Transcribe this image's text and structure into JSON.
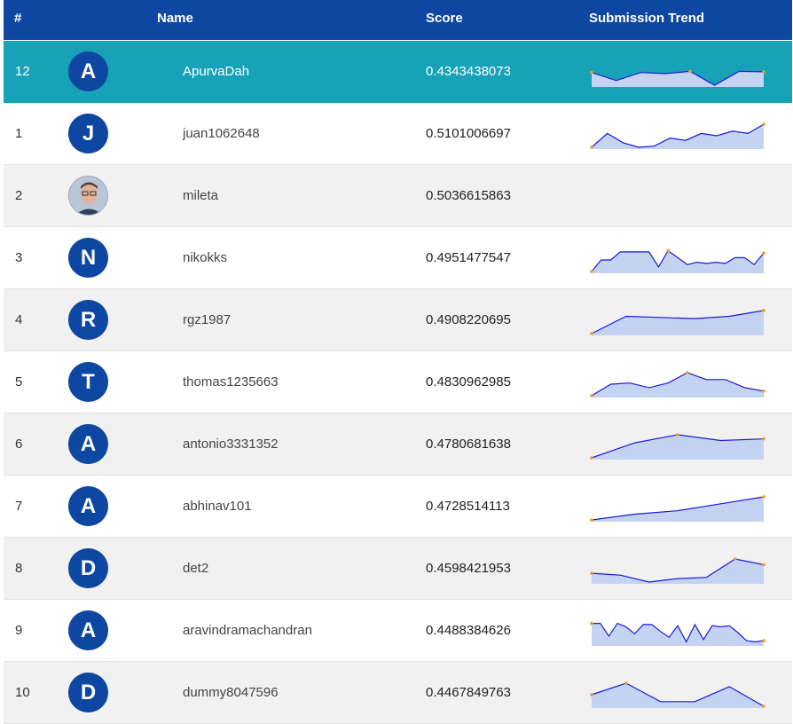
{
  "header": {
    "rank": "#",
    "name": "Name",
    "score": "Score",
    "trend": "Submission Trend"
  },
  "colors": {
    "header": "#0d47a1",
    "highlight": "#17a2b8",
    "avatar": "#0d47a1",
    "line": "#1a1ad6",
    "fill": "#c5d3f3",
    "marker": "#f29c2b"
  },
  "rows": [
    {
      "rank": "12",
      "initial": "A",
      "name": "ApurvaDah",
      "score": "0.4343438073",
      "highlight": true,
      "trend": [
        0.55,
        0.2,
        0.55,
        0.5,
        0.6,
        0.0,
        0.6,
        0.58
      ],
      "photo": false
    },
    {
      "rank": "1",
      "initial": "J",
      "name": "juan1062648",
      "score": "0.5101006697",
      "trend": [
        0.0,
        0.6,
        0.2,
        0.0,
        0.05,
        0.4,
        0.3,
        0.6,
        0.5,
        0.7,
        0.6,
        1.0
      ],
      "photo": false
    },
    {
      "rank": "2",
      "initial": "",
      "name": "mileta",
      "score": "0.5036615863",
      "trend": [],
      "photo": true
    },
    {
      "rank": "3",
      "initial": "N",
      "name": "nikokks",
      "score": "0.4951477547",
      "trend": [
        0.0,
        0.5,
        0.5,
        0.85,
        0.85,
        0.85,
        0.85,
        0.2,
        0.9,
        0.6,
        0.3,
        0.4,
        0.35,
        0.4,
        0.35,
        0.6,
        0.6,
        0.3,
        0.8
      ],
      "photo": false
    },
    {
      "rank": "4",
      "initial": "R",
      "name": "rgz1987",
      "score": "0.4908220695",
      "trend": [
        0.0,
        0.75,
        0.7,
        0.65,
        0.75,
        1.0
      ],
      "photo": false
    },
    {
      "rank": "5",
      "initial": "T",
      "name": "thomas1235663",
      "score": "0.4830962985",
      "trend": [
        0.0,
        0.5,
        0.55,
        0.35,
        0.55,
        1.0,
        0.7,
        0.7,
        0.35,
        0.2
      ],
      "photo": false
    },
    {
      "rank": "6",
      "initial": "A",
      "name": "antonio3331352",
      "score": "0.4780681638",
      "trend": [
        0.0,
        0.65,
        1.0,
        0.75,
        0.82
      ],
      "photo": false
    },
    {
      "rank": "7",
      "initial": "A",
      "name": "abhinav101",
      "score": "0.4728514113",
      "trend": [
        0.0,
        0.25,
        0.4,
        0.7,
        1.0
      ],
      "photo": false
    },
    {
      "rank": "8",
      "initial": "D",
      "name": "det2",
      "score": "0.4598421953",
      "trend": [
        0.38,
        0.3,
        0.0,
        0.15,
        0.2,
        1.0,
        0.75
      ],
      "photo": false
    },
    {
      "rank": "9",
      "initial": "A",
      "name": "aravindramachandran",
      "score": "0.4488384626",
      "trend": [
        0.9,
        0.9,
        0.35,
        0.9,
        0.75,
        0.45,
        0.85,
        0.85,
        0.55,
        0.3,
        0.8,
        0.1,
        0.85,
        0.2,
        0.8,
        0.75,
        0.8,
        0.5,
        0.15,
        0.1,
        0.15
      ],
      "photo": false
    },
    {
      "rank": "10",
      "initial": "D",
      "name": "dummy8047596",
      "score": "0.4467849763",
      "trend": [
        0.5,
        1.0,
        0.2,
        0.2,
        0.85,
        0.0
      ],
      "photo": false
    }
  ]
}
